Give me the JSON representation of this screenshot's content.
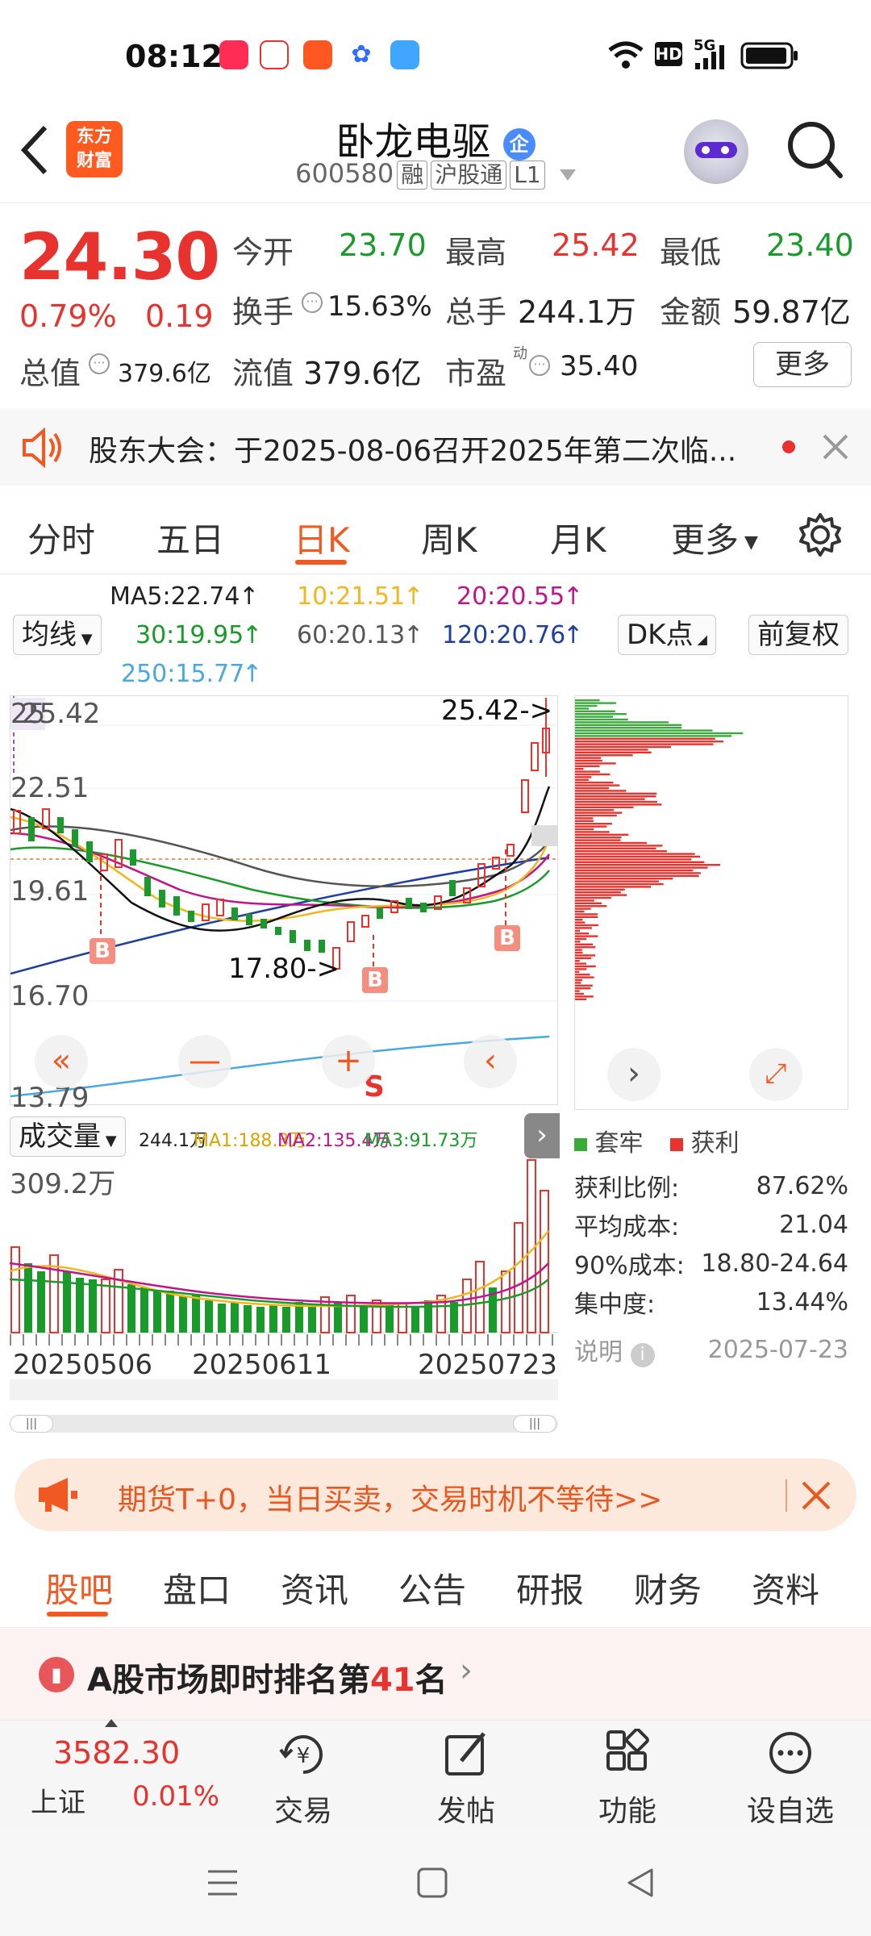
{
  "status": {
    "time": "08:12",
    "net": "HD",
    "signal": "5G"
  },
  "header": {
    "logo_line1": "东方",
    "logo_line2": "财富",
    "title": "卧龙电驱",
    "badge": "企",
    "code": "600580",
    "tags": [
      "融",
      "沪股通",
      "L1"
    ]
  },
  "quote": {
    "price": "24.30",
    "pct": "0.79%",
    "chg": "0.19",
    "open_label": "今开",
    "open": "23.70",
    "high_label": "最高",
    "high": "25.42",
    "low_label": "最低",
    "low": "23.40",
    "turnover_label": "换手",
    "turnover": "15.63%",
    "vol_label": "总手",
    "vol": "244.1万",
    "amount_label": "金额",
    "amount": "59.87亿",
    "mcap_label": "总值",
    "mcap": "379.6亿",
    "float_label": "流值",
    "float": "379.6亿",
    "pe_label": "市盈",
    "pe_sup": "动",
    "pe": "35.40",
    "more": "更多"
  },
  "notice": {
    "text": "股东大会：于2025-08-06召开2025年第二次临..."
  },
  "ktabs": [
    "分时",
    "五日",
    "日K",
    "周K",
    "月K",
    "更多"
  ],
  "ma": {
    "selector": "均线",
    "ma5": "MA5:22.74",
    "ma10": "10:21.51",
    "ma20": "20:20.55",
    "ma30": "30:19.95",
    "ma60": "60:20.13",
    "ma120": "120:20.76",
    "ma250": "250:15.77",
    "dk": "DK点",
    "fq": "前复权"
  },
  "chart_axis": {
    "y_top": "25.42",
    "y1": "22.51",
    "y2": "19.61",
    "y3": "16.70",
    "y_bottom": "13.79",
    "top_prefix": "25",
    "high_mark": "25.42->",
    "low_mark": "17.80->",
    "buy": "B",
    "sell": "S"
  },
  "volume": {
    "selector": "成交量",
    "cur": "244.1万",
    "ma1": "MA1:188.3万",
    "ma2": "MA2:135.4万",
    "ma3": "MA3:91.73万",
    "ymax": "309.2万",
    "dates": [
      "20250506",
      "20250611",
      "20250723"
    ]
  },
  "chips": {
    "legend_trap": "套牢",
    "legend_profit": "获利",
    "rows": [
      {
        "label": "获利比例:",
        "value": "87.62%"
      },
      {
        "label": "平均成本:",
        "value": "21.04"
      },
      {
        "label": "90%成本:",
        "value": "18.80-24.64"
      },
      {
        "label": "集中度:",
        "value": "13.44%"
      }
    ],
    "note_label": "说明",
    "note_date": "2025-07-23"
  },
  "ad": {
    "text": "期货T+0，当日买卖，交易时机不等待>>"
  },
  "bottom_tabs": [
    "股吧",
    "盘口",
    "资讯",
    "公告",
    "研报",
    "财务",
    "资料"
  ],
  "rank": {
    "prefix": "A股市场即时排名第",
    "num": "41",
    "suffix": "名"
  },
  "dock": {
    "index_value": "3582.30",
    "index_name": "上证",
    "index_pct": "0.01%",
    "items": [
      "交易",
      "发帖",
      "功能",
      "设自选"
    ]
  },
  "colors": {
    "up": "#e8322e",
    "down": "#1a9a2b",
    "accent": "#f05a22"
  }
}
